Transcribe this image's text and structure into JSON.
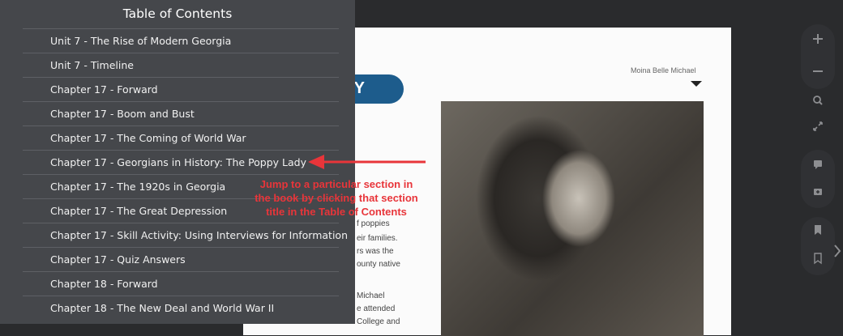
{
  "toc": {
    "title": "Table of Contents",
    "items": [
      {
        "label": "Unit 7 - The Rise of Modern Georgia"
      },
      {
        "label": "Unit 7 - Timeline"
      },
      {
        "label": "Chapter 17 - Forward"
      },
      {
        "label": "Chapter 17 - Boom and Bust"
      },
      {
        "label": "Chapter 17 - The Coming of World War"
      },
      {
        "label": "Chapter 17 - Georgians in History: The Poppy Lady"
      },
      {
        "label": "Chapter 17 - The 1920s in Georgia"
      },
      {
        "label": "Chapter 17 - The Great Depression"
      },
      {
        "label": "Chapter 17 - Skill Activity: Using Interviews for Information"
      },
      {
        "label": "Chapter 17 - Quiz Answers"
      },
      {
        "label": "Chapter 18 - Forward"
      },
      {
        "label": "Chapter 18 - The New Deal and World War II"
      }
    ]
  },
  "annotation": {
    "line1": "Jump to a particular section in",
    "line2": "the book by clicking that section",
    "line3": "title in the Table of Contents",
    "color": "#e8353a"
  },
  "book_page": {
    "caption": "Moina Belle Michael",
    "pill_text": "Y",
    "text_fragments": [
      "f poppies",
      "eir families.",
      "rs was the",
      "ounty native",
      "Michael",
      "e attended",
      "College and"
    ]
  },
  "toolbar": {
    "icons": [
      "plus-icon",
      "minus-icon",
      "search-icon",
      "fullscreen-icon",
      "comment-icon",
      "add-comment-icon",
      "bookmark-icon",
      "bookmark-outline-icon"
    ]
  },
  "colors": {
    "toc_background": "#45474b",
    "page_background": "#fbfbfb",
    "app_background": "#2a2b2d",
    "accent_blue": "#1d5c8c"
  }
}
